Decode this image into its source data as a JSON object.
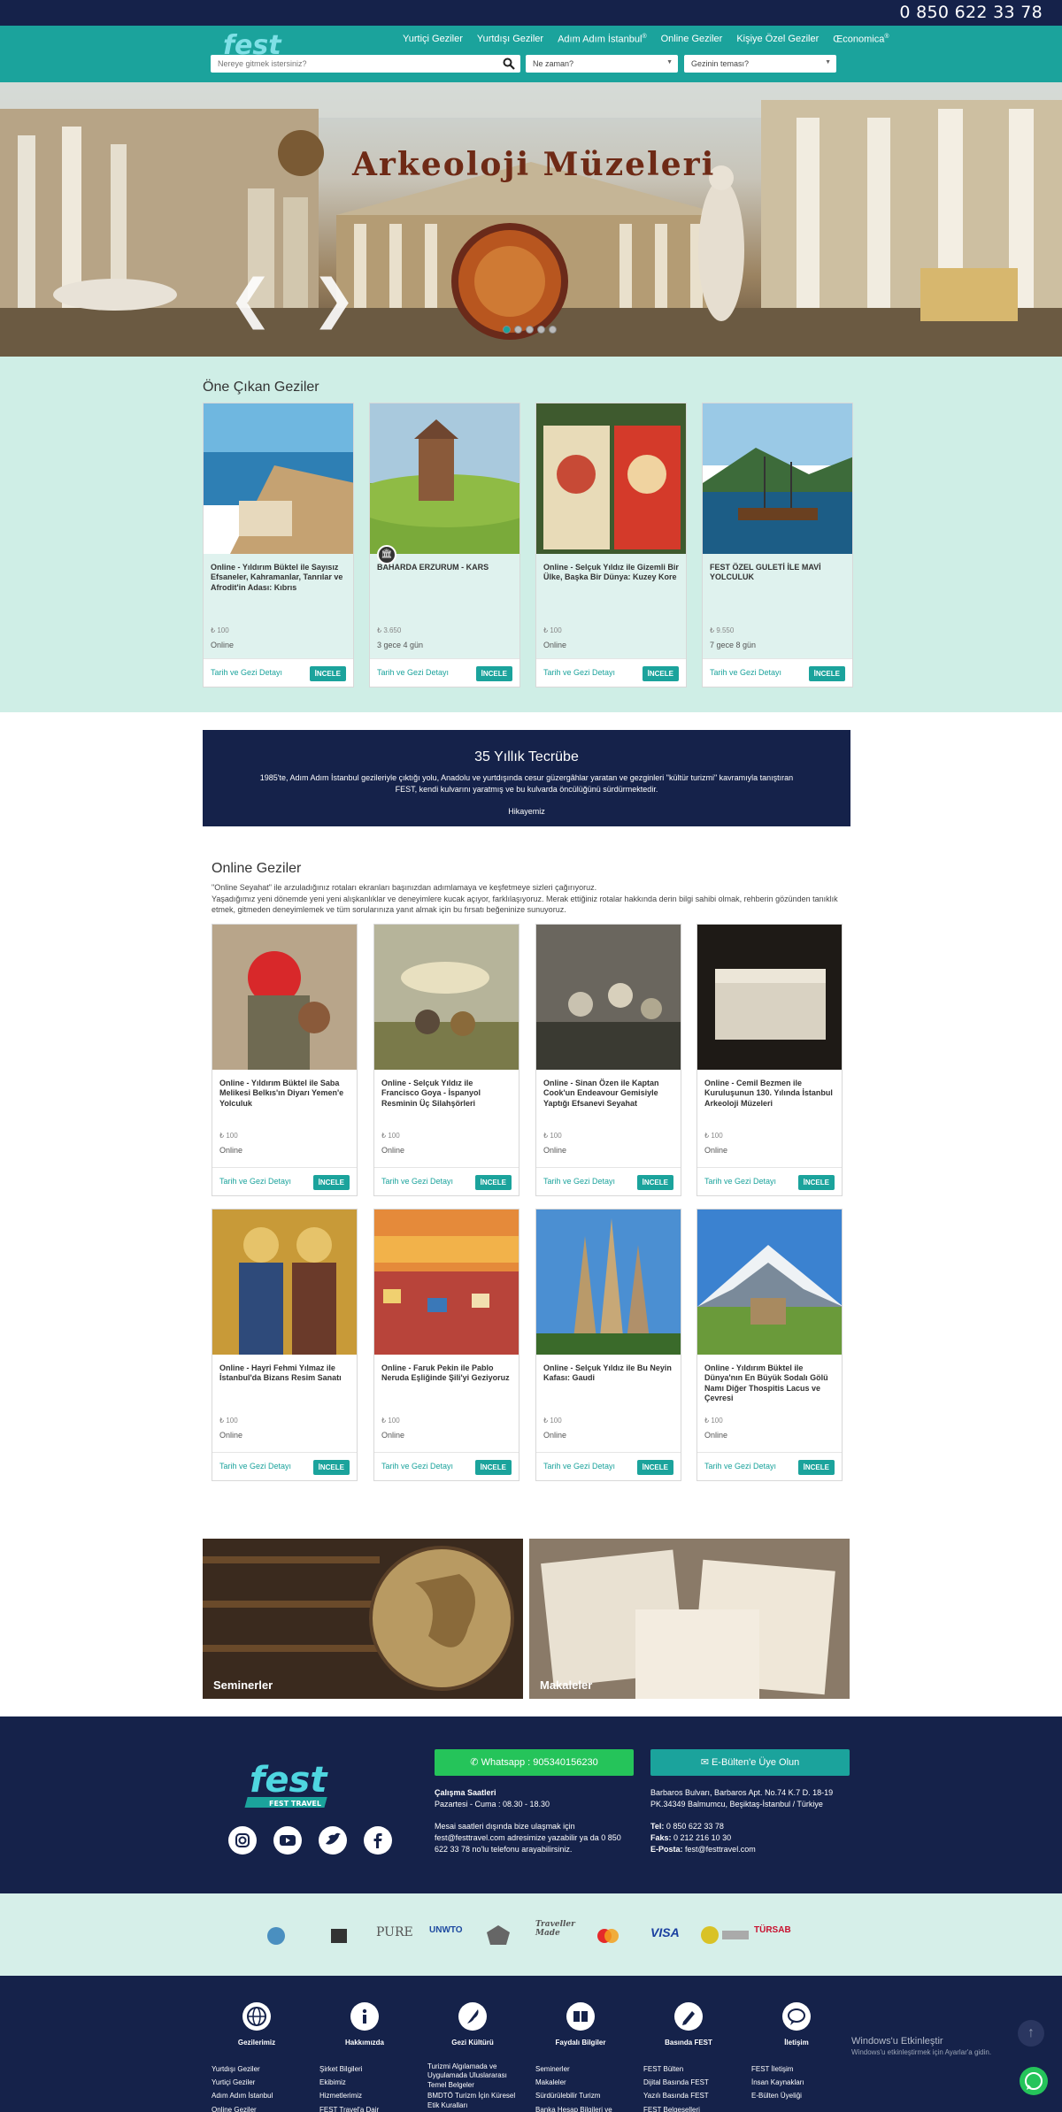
{
  "topbar": {
    "phone": "0 850 622 33 78"
  },
  "nav": {
    "items": [
      "Yurtiçi Geziler",
      "Yurtdışı Geziler",
      "Adım Adım İstanbul",
      "Online Geziler",
      "Kişiye Özel Geziler",
      "Œconomica"
    ],
    "sup_marks": [
      "",
      "",
      "®",
      "",
      "",
      "®"
    ]
  },
  "search": {
    "placeholder": "Nereye gitmek istersiniz?",
    "when": "Ne zaman?",
    "theme": "Gezinin teması?"
  },
  "hero": {
    "title": "Arkeoloji Müzeleri",
    "prev": "❮",
    "next": "❯",
    "slides": 5,
    "active_slide": 1
  },
  "featured": {
    "title": "Öne Çıkan Geziler",
    "cards": [
      {
        "title": "Online - Yıldırım Büktel ile Sayısız Efsaneler, Kahramanlar, Tanrılar ve Afrodit'in Adası: Kıbrıs",
        "price": "₺ 100",
        "duration": "Online",
        "link": "Tarih ve Gezi Detayı",
        "button": "İNCELE"
      },
      {
        "title": "BAHARDA ERZURUM - KARS",
        "price": "₺ 3.650",
        "duration": "3 gece 4 gün",
        "link": "Tarih ve Gezi Detayı",
        "button": "İNCELE"
      },
      {
        "title": "Online - Selçuk Yıldız ile Gizemli Bir Ülke, Başka Bir Dünya: Kuzey Kore",
        "price": "₺ 100",
        "duration": "Online",
        "link": "Tarih ve Gezi Detayı",
        "button": "İNCELE"
      },
      {
        "title": "FEST ÖZEL GULETİ İLE MAVİ YOLCULUK",
        "price": "₺ 9.550",
        "duration": "7 gece 8 gün",
        "link": "Tarih ve Gezi Detayı",
        "button": "İNCELE"
      }
    ]
  },
  "experience": {
    "title": "35 Yıllık Tecrübe",
    "text": "1985'te, Adım Adım İstanbul gezileriyle çıktığı yolu, Anadolu ve yurtdışında cesur güzergâhlar yaratan ve gezginleri \"kültür turizmi\" kavramıyla tanıştıran FEST, kendi kulvarını yaratmış ve bu kulvarda öncülüğünü sürdürmektedir.",
    "link": "Hikayemiz"
  },
  "online": {
    "title": "Online Geziler",
    "desc1": "\"Online Seyahat\" ile arzuladığınız rotaları ekranları başınızdan adımlamaya ve keşfetmeye sizleri çağırıyoruz.",
    "desc2": "Yaşadığımız yeni dönemde yeni yeni alışkanlıklar ve deneyimlere kucak açıyor, farklılaşıyoruz. Merak ettiğiniz rotalar hakkında derin bilgi sahibi olmak, rehberin gözünden tanıklık etmek, gitmeden deneyimlemek ve tüm sorularınıza yanıt almak için bu fırsatı beğeninize sunuyoruz.",
    "cards": [
      {
        "title": "Online - Yıldırım Büktel ile Saba Melikesi Belkıs'ın Diyarı Yemen'e Yolculuk",
        "price": "₺ 100",
        "duration": "Online",
        "link": "Tarih ve Gezi Detayı",
        "button": "İNCELE"
      },
      {
        "title": "Online - Selçuk Yıldız ile Francisco Goya - İspanyol Resminin Üç Silahşörleri",
        "price": "₺ 100",
        "duration": "Online",
        "link": "Tarih ve Gezi Detayı",
        "button": "İNCELE"
      },
      {
        "title": "Online - Sinan Özen ile Kaptan Cook'un Endeavour Gemisiyle Yaptığı Efsanevi Seyahat",
        "price": "₺ 100",
        "duration": "Online",
        "link": "Tarih ve Gezi Detayı",
        "button": "İNCELE"
      },
      {
        "title": "Online - Cemil Bezmen ile Kuruluşunun 130. Yılında İstanbul Arkeoloji Müzeleri",
        "price": "₺ 100",
        "duration": "Online",
        "link": "Tarih ve Gezi Detayı",
        "button": "İNCELE"
      },
      {
        "title": "Online - Hayri Fehmi Yılmaz ile İstanbul'da Bizans Resim Sanatı",
        "price": "₺ 100",
        "duration": "Online",
        "link": "Tarih ve Gezi Detayı",
        "button": "İNCELE"
      },
      {
        "title": "Online - Faruk Pekin ile Pablo Neruda Eşliğinde Şili'yi Geziyoruz",
        "price": "₺ 100",
        "duration": "Online",
        "link": "Tarih ve Gezi Detayı",
        "button": "İNCELE"
      },
      {
        "title": "Online - Selçuk Yıldız ile Bu Neyin Kafası: Gaudi",
        "price": "₺ 100",
        "duration": "Online",
        "link": "Tarih ve Gezi Detayı",
        "button": "İNCELE"
      },
      {
        "title": "Online - Yıldırım Büktel ile Dünya'nın En Büyük Sodalı Gölü Namı Diğer Thospitis Lacus ve Çevresi",
        "price": "₺ 100",
        "duration": "Online",
        "link": "Tarih ve Gezi Detayı",
        "button": "İNCELE"
      }
    ]
  },
  "banners": {
    "left": "Seminerler",
    "right": "Makaleler"
  },
  "footer": {
    "logo_text": "fest",
    "logo_sub": "FEST TRAVEL",
    "whatsapp": "Whatsapp : 905340156230",
    "newsletter": "E-Bülten'e Üye Olun",
    "hours_title": "Çalışma Saatleri",
    "hours": "Pazartesi - Cuma : 08.30 - 18.30",
    "hours_note": "Mesai saatleri dışında bize ulaşmak için fest@festtravel.com adresimize yazabilir ya da 0 850 622 33 78 no'lu telefonu arayabilirsiniz.",
    "address": "Barbaros Bulvarı, Barbaros Apt. No.74 K.7 D. 18-19 PK.34349 Balmumcu, Beşiktaş-İstanbul / Türkiye",
    "tel_label": "Tel:",
    "tel": "0 850 622 33 78",
    "fax_label": "Faks:",
    "fax": "0 212 216 10 30",
    "email_label": "E-Posta:",
    "email": "fest@festtravel.com"
  },
  "partners": [
    "PURE",
    "UNWTO",
    "Traveller Made",
    "VISA",
    "TÜRSAB"
  ],
  "bottom": {
    "columns": [
      {
        "title": "Gezilerimiz",
        "links": [
          "Yurtdışı Geziler",
          "Yurtiçi Geziler",
          "Adım Adım İstanbul",
          "Online Geziler"
        ]
      },
      {
        "title": "Hakkımızda",
        "links": [
          "Şirket Bilgileri",
          "Ekibimiz",
          "Hizmetlerimiz",
          "FEST Travel'a Dair"
        ]
      },
      {
        "title": "Gezi Kültürü",
        "links": [
          "Turizmi Algılamada ve Uygulamada Uluslararası Temel Belgeler",
          "BMDTÖ Turizm İçin Küresel Etik Kuralları"
        ]
      },
      {
        "title": "Faydalı Bilgiler",
        "links": [
          "Seminerler",
          "Makaleler",
          "Sürdürülebilir Turizm",
          "Banka Hesap Bilgileri ve"
        ]
      },
      {
        "title": "Basında FEST",
        "links": [
          "FEST Bülten",
          "Dijital Basında FEST",
          "Yazılı Basında FEST",
          "FEST Belgeselleri"
        ]
      },
      {
        "title": "İletişim",
        "links": [
          "FEST İletişim",
          "İnsan Kaynakları",
          "E-Bülten Üyeliği"
        ]
      }
    ],
    "windows_title": "Windows'u Etkinleştir",
    "windows_sub": "Windows'u etkinleştirmek için Ayarlar'a gidin."
  },
  "colors": {
    "navy": "#15224a",
    "teal": "#1ba39c",
    "mint": "#cfeee6",
    "whatsapp": "#25c45a"
  }
}
